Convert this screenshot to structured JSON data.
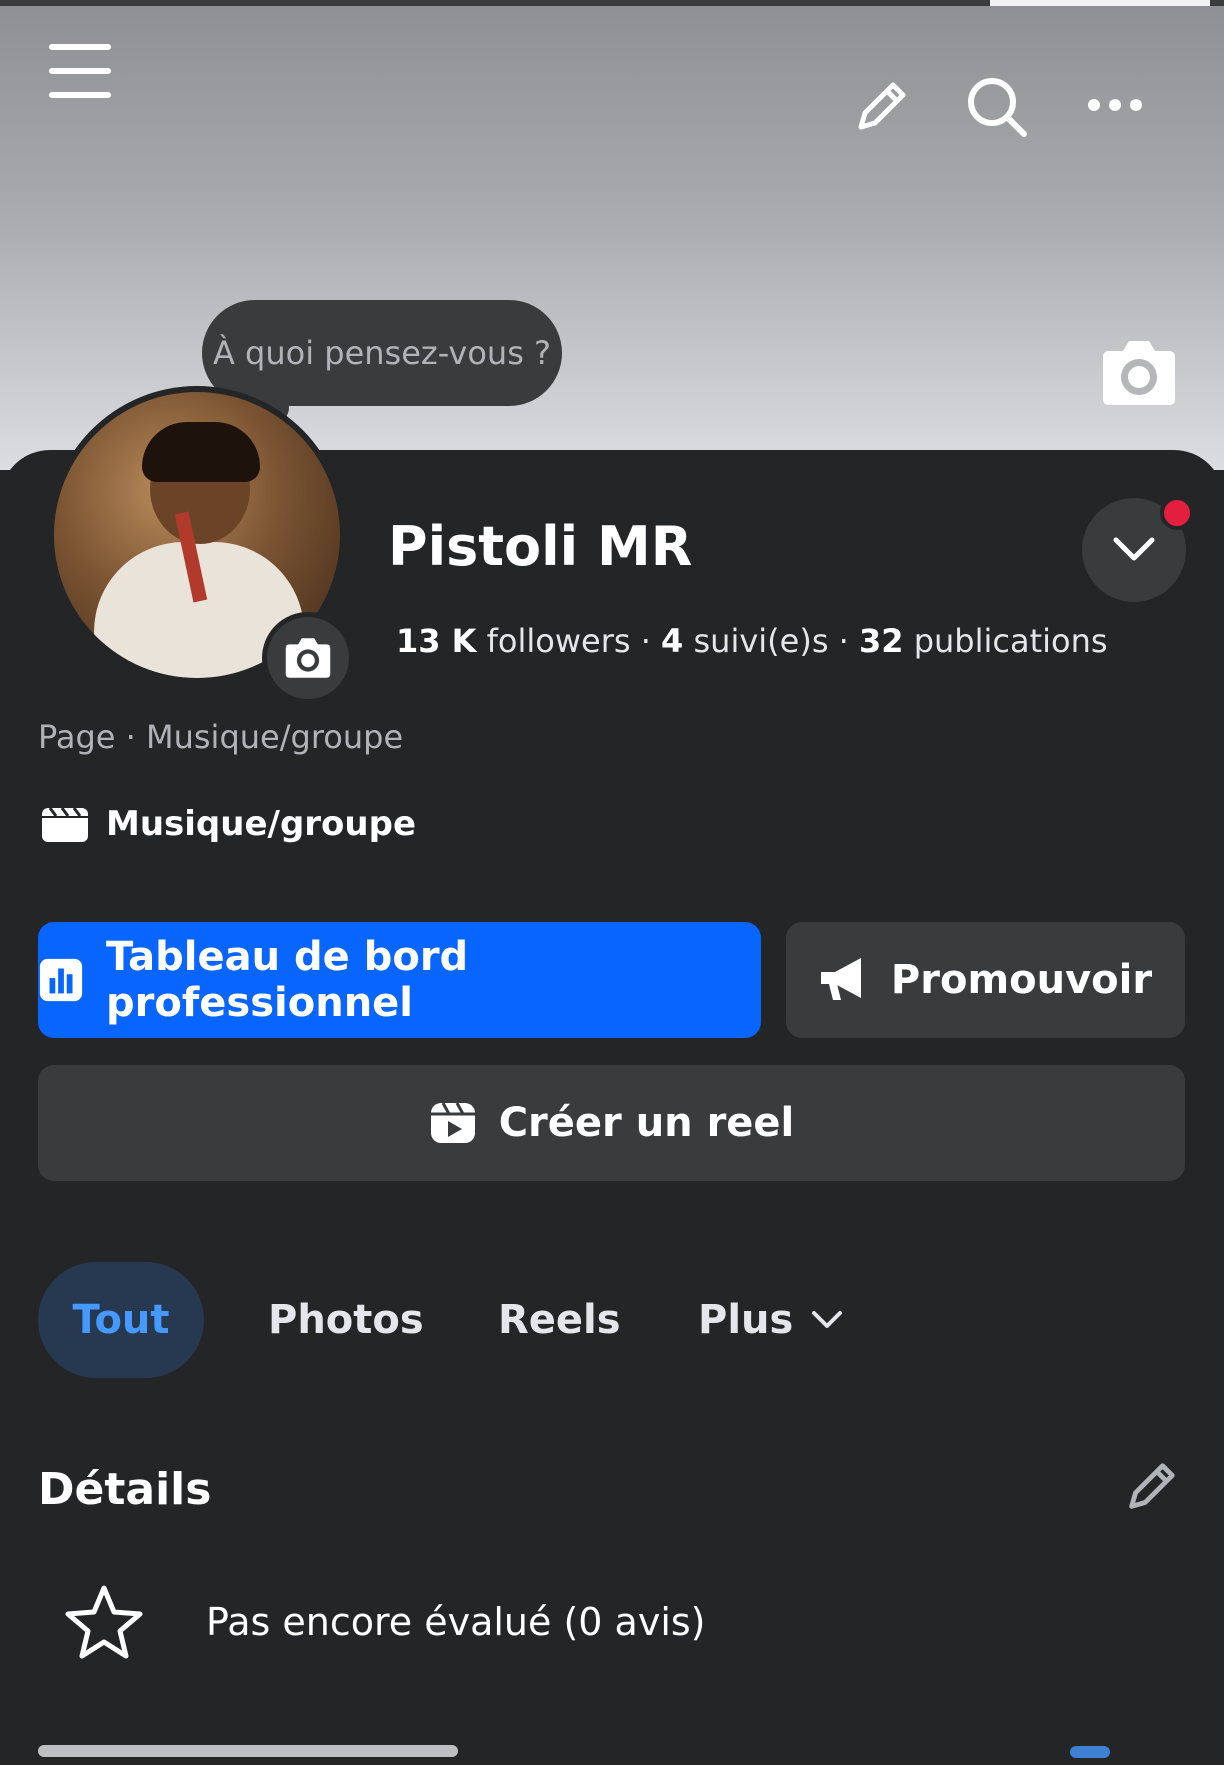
{
  "header": {
    "menu_icon": "hamburger-menu-icon",
    "edit_icon": "pencil-icon",
    "search_icon": "search-icon",
    "more_icon": "more-horizontal-icon",
    "cover_camera_icon": "camera-icon"
  },
  "composer": {
    "placeholder": "À quoi pensez-vous ?"
  },
  "profile": {
    "name": "Pistoli MR",
    "followers_count": "13 K",
    "followers_label": "followers",
    "following_count": "4",
    "following_label": "suivi(e)s",
    "posts_count": "32",
    "posts_label": "publications",
    "separator": "·",
    "page_type": "Page · Musique/groupe",
    "category": "Musique/groupe"
  },
  "actions": {
    "dashboard_label": "Tableau de bord professionnel",
    "promote_label": "Promouvoir",
    "create_reel_label": "Créer un reel"
  },
  "tabs": [
    {
      "label": "Tout",
      "active": true
    },
    {
      "label": "Photos",
      "active": false
    },
    {
      "label": "Reels",
      "active": false
    },
    {
      "label": "Plus",
      "active": false
    }
  ],
  "details": {
    "title": "Détails",
    "rating_text": "Pas encore évalué (0 avis)"
  },
  "colors": {
    "background": "#242526",
    "primary": "#0866ff",
    "active_tab_bg": "#263951",
    "active_tab_text": "#4599ff",
    "notification": "#e41e3f"
  }
}
